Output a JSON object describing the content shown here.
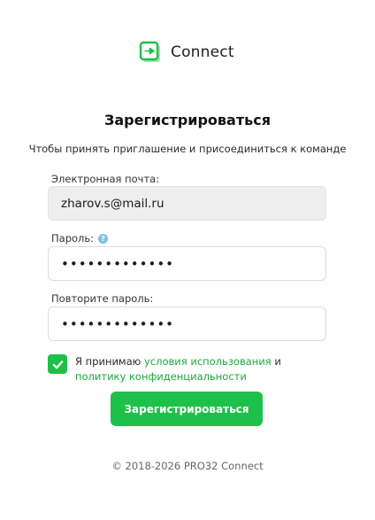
{
  "brand": {
    "name": "Connect",
    "icon": "connect-logo-icon",
    "accent_color": "#1ec04a"
  },
  "form": {
    "title": "Зарегистрироваться",
    "subtitle": "Чтобы принять приглашение и присоединиться к команде",
    "email": {
      "label": "Электронная почта:",
      "value": "zharov.s@mail.ru"
    },
    "password": {
      "label": "Пароль:",
      "help_icon": "?",
      "masked_value": "•••••••••••••"
    },
    "password_repeat": {
      "label": "Повторите пароль:",
      "masked_value": "•••••••••••••"
    },
    "agreement": {
      "checked": true,
      "text_prefix": "Я принимаю ",
      "terms_link": "условия использования",
      "conjunction": " и ",
      "privacy_link": "политику конфиденциальности"
    },
    "submit_label": "Зарегистрироваться"
  },
  "footer": {
    "copyright": "© 2018-2026 PRO32 Connect"
  }
}
